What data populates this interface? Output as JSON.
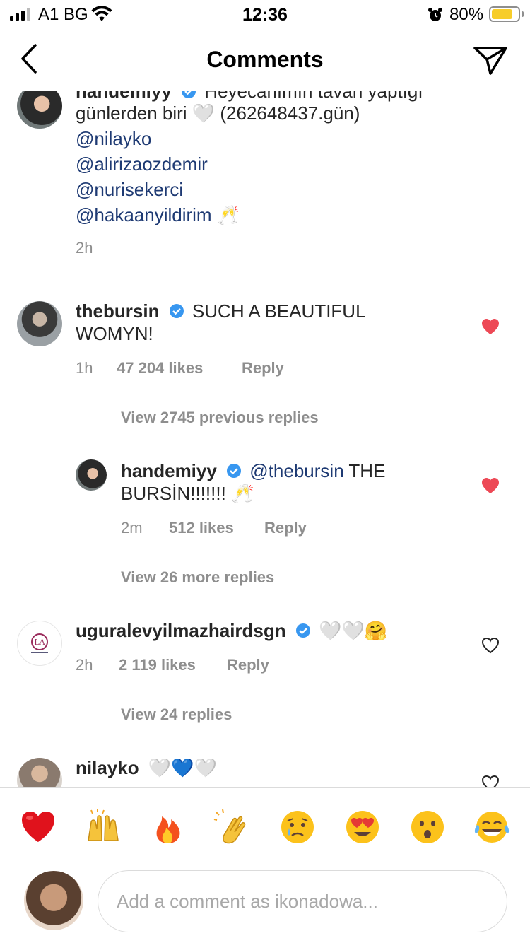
{
  "status_bar": {
    "carrier": "A1 BG",
    "time": "12:36",
    "battery_percent": "80%",
    "battery_level": 0.8,
    "battery_color": "#f7cd2a"
  },
  "header": {
    "title": "Comments",
    "back_icon": "chevron-left-icon",
    "share_icon": "paper-plane-icon"
  },
  "caption": {
    "username": "handemiyy",
    "text_line1": "Heyecanımın tavan yaptığı",
    "text_line2": "günlerden biri 🤍 (262648437.gün)",
    "mentions": [
      "@nilayko",
      "@alirizaozdemir",
      "@nurisekerci",
      "@hakaanyildirim"
    ],
    "mention_emoji": "🥂",
    "time": "2h"
  },
  "comments": [
    {
      "username": "thebursin",
      "verified": true,
      "text_line1": "SUCH A BEAUTIFUL",
      "text_line2": "WOMYN!",
      "time": "1h",
      "likes": "47 204 likes",
      "reply_label": "Reply",
      "liked": true,
      "view_replies": "View 2745 previous replies",
      "replies": [
        {
          "username": "handemiyy",
          "verified": true,
          "mention": "@thebursin",
          "text_line1": "THE",
          "text_line2": "BURSİN!!!!!!!",
          "emoji": "🥂",
          "time": "2m",
          "likes": "512 likes",
          "reply_label": "Reply",
          "liked": true
        }
      ],
      "view_more": "View 26 more replies"
    },
    {
      "username": "uguralevyilmazhairdsgn",
      "verified": true,
      "text": "🤍🤍🤗",
      "time": "2h",
      "likes": "2 119 likes",
      "reply_label": "Reply",
      "liked": false,
      "view_replies": "View 24 replies"
    },
    {
      "username": "nilayko",
      "text": "🤍💙🤍",
      "liked": false
    }
  ],
  "emoji_bar": [
    "❤️",
    "🙌",
    "🔥",
    "👏",
    "😢",
    "😍",
    "😮",
    "😂"
  ],
  "composer": {
    "placeholder": "Add a comment as ikonadowa..."
  },
  "colors": {
    "like_red": "#ed4956",
    "mention_blue": "#1e3a73",
    "verified_blue": "#3897f0",
    "meta_gray": "#8e8e8e"
  }
}
